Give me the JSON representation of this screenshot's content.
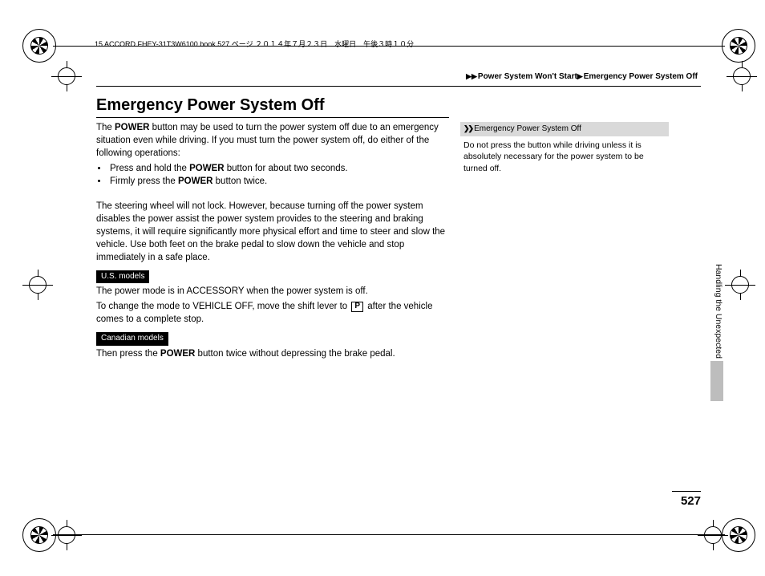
{
  "header_strip": "15 ACCORD FHEY-31T3W6100.book   527 ページ   ２０１４年７月２３日　水曜日　午後３時１０分",
  "breadcrumb": {
    "parent": "Power System Won't Start",
    "current": "Emergency Power System Off"
  },
  "title": "Emergency Power System Off",
  "main": {
    "intro1a": "The ",
    "power": "POWER",
    "intro1b": " button may be used to turn the power system off due to an emergency situation even while driving. If you must turn the power system off, do either of the following operations:",
    "bullet1a": "Press and hold the ",
    "bullet1b": " button for about two seconds.",
    "bullet2a": "Firmly press the ",
    "bullet2b": " button twice.",
    "para2": "The steering wheel will not lock. However, because turning off the power system disables the power assist the power system provides to the steering and braking systems, it will require significantly more physical effort and time to steer and slow the vehicle. Use both feet on the brake pedal to slow down the vehicle and stop immediately in a safe place.",
    "us_label": "U.S. models",
    "us_p1": "The power mode is in ACCESSORY when the power system is off.",
    "us_p2a": "To change the mode to VEHICLE OFF, move the shift lever to ",
    "p_letter": "P",
    "us_p2b": " after the vehicle comes to a complete stop.",
    "ca_label": "Canadian models",
    "ca_p1a": "Then press the ",
    "ca_p1b": " button twice without depressing the brake pedal."
  },
  "sidebar": {
    "head": "Emergency Power System Off",
    "body": "Do not press the button while driving unless it is absolutely necessary for the power system to be turned off."
  },
  "vtab": "Handling the Unexpected",
  "page_number": "527"
}
